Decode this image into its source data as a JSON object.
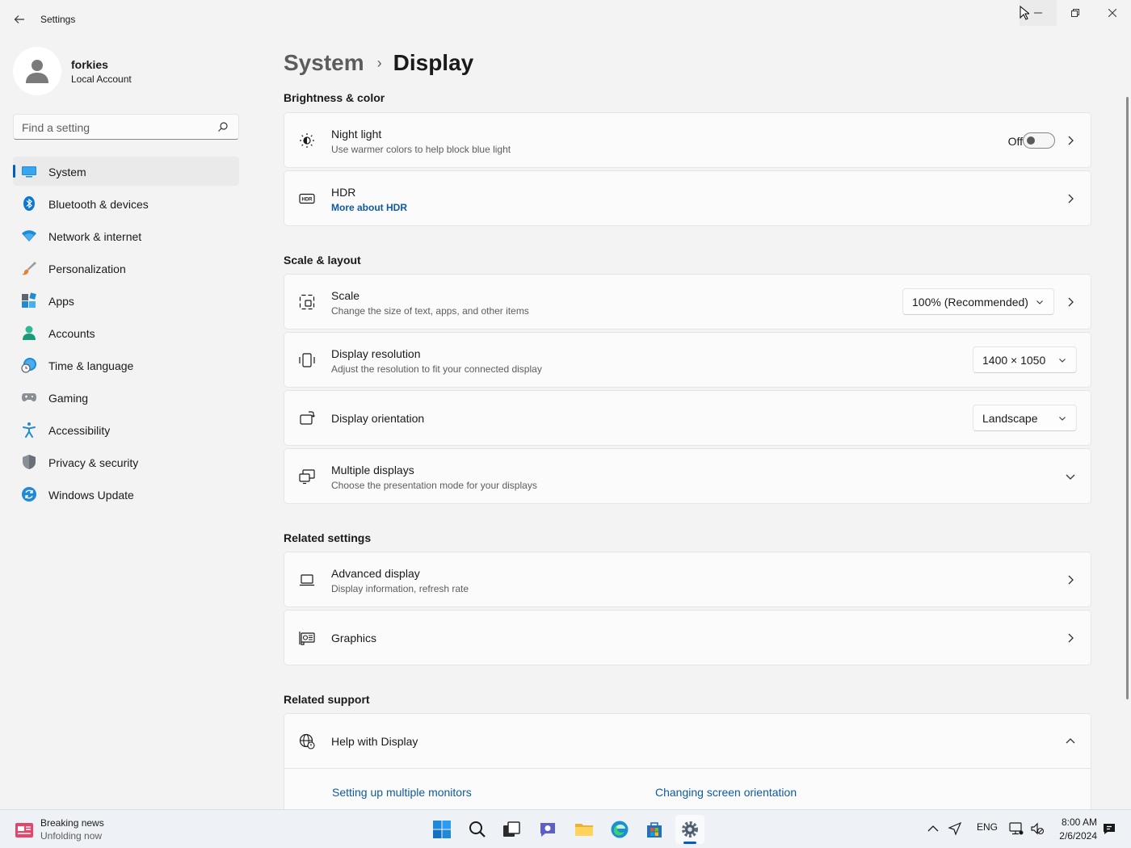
{
  "window": {
    "title": "Settings"
  },
  "profile": {
    "name": "forkies",
    "account_type": "Local Account"
  },
  "search": {
    "placeholder": "Find a setting"
  },
  "sidebar": {
    "items": [
      {
        "label": "System",
        "icon": "system-icon",
        "selected": true
      },
      {
        "label": "Bluetooth & devices",
        "icon": "bluetooth-icon"
      },
      {
        "label": "Network & internet",
        "icon": "wifi-icon"
      },
      {
        "label": "Personalization",
        "icon": "brush-icon"
      },
      {
        "label": "Apps",
        "icon": "apps-icon"
      },
      {
        "label": "Accounts",
        "icon": "accounts-icon"
      },
      {
        "label": "Time & language",
        "icon": "clock-globe-icon"
      },
      {
        "label": "Gaming",
        "icon": "gamepad-icon"
      },
      {
        "label": "Accessibility",
        "icon": "accessibility-icon"
      },
      {
        "label": "Privacy & security",
        "icon": "shield-icon"
      },
      {
        "label": "Windows Update",
        "icon": "update-icon"
      }
    ]
  },
  "breadcrumb": {
    "parent": "System",
    "separator": "›",
    "current": "Display"
  },
  "sections": {
    "brightness": "Brightness & color",
    "scale_layout": "Scale & layout",
    "related_settings": "Related settings",
    "related_support": "Related support"
  },
  "night_light": {
    "title": "Night light",
    "subtitle": "Use warmer colors to help block blue light",
    "state": "Off"
  },
  "hdr": {
    "title": "HDR",
    "link": "More about HDR"
  },
  "scale": {
    "title": "Scale",
    "subtitle": "Change the size of text, apps, and other items",
    "value": "100% (Recommended)"
  },
  "resolution": {
    "title": "Display resolution",
    "subtitle": "Adjust the resolution to fit your connected display",
    "value": "1400 × 1050"
  },
  "orientation": {
    "title": "Display orientation",
    "value": "Landscape"
  },
  "multiple_displays": {
    "title": "Multiple displays",
    "subtitle": "Choose the presentation mode for your displays"
  },
  "advanced_display": {
    "title": "Advanced display",
    "subtitle": "Display information, refresh rate"
  },
  "graphics": {
    "title": "Graphics"
  },
  "help": {
    "title": "Help with Display",
    "links": [
      "Setting up multiple monitors",
      "Changing screen orientation"
    ]
  },
  "taskbar": {
    "news_title": "Breaking news",
    "news_subtitle": "Unfolding now",
    "language": "ENG",
    "time": "8:00 AM",
    "date": "2/6/2024"
  },
  "colors": {
    "accent": "#005fb8",
    "link": "#0f5aa0",
    "background": "#f3f3f3"
  }
}
